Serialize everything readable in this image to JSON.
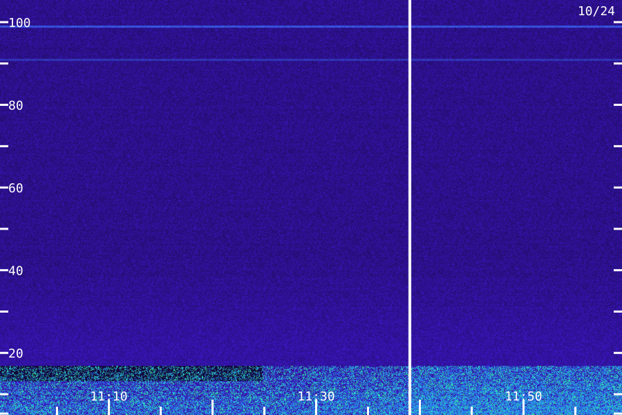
{
  "chart_data": {
    "type": "heatmap",
    "title": "",
    "xlabel": "",
    "ylabel": "",
    "date_label": "10/24",
    "y_ticks_labeled": [
      "100",
      "80",
      "60",
      "40",
      "20"
    ],
    "y_ticks_minor": [
      90,
      70,
      50,
      30,
      10,
      0
    ],
    "y_range": [
      0,
      100
    ],
    "x_tick_labels": [
      "11:10",
      "11:30",
      "11:50"
    ],
    "x_range": [
      "11:00",
      "12:00"
    ],
    "gap_time": "11:39",
    "features": [
      {
        "kind": "narrowband-line",
        "y": 99,
        "intensity": 0.85
      },
      {
        "kind": "narrowband-line",
        "y": 91,
        "intensity": 0.45
      },
      {
        "kind": "low-frequency-energy",
        "y_max": 17,
        "intensity": 0.9
      }
    ],
    "colors": {
      "background": "#1a0850",
      "noise_low": "#2a0a8a",
      "noise_high": "#3b22e6",
      "band": "#2bd3d8",
      "band_strong": "#3cff8c",
      "axis": "#ffffff"
    }
  }
}
